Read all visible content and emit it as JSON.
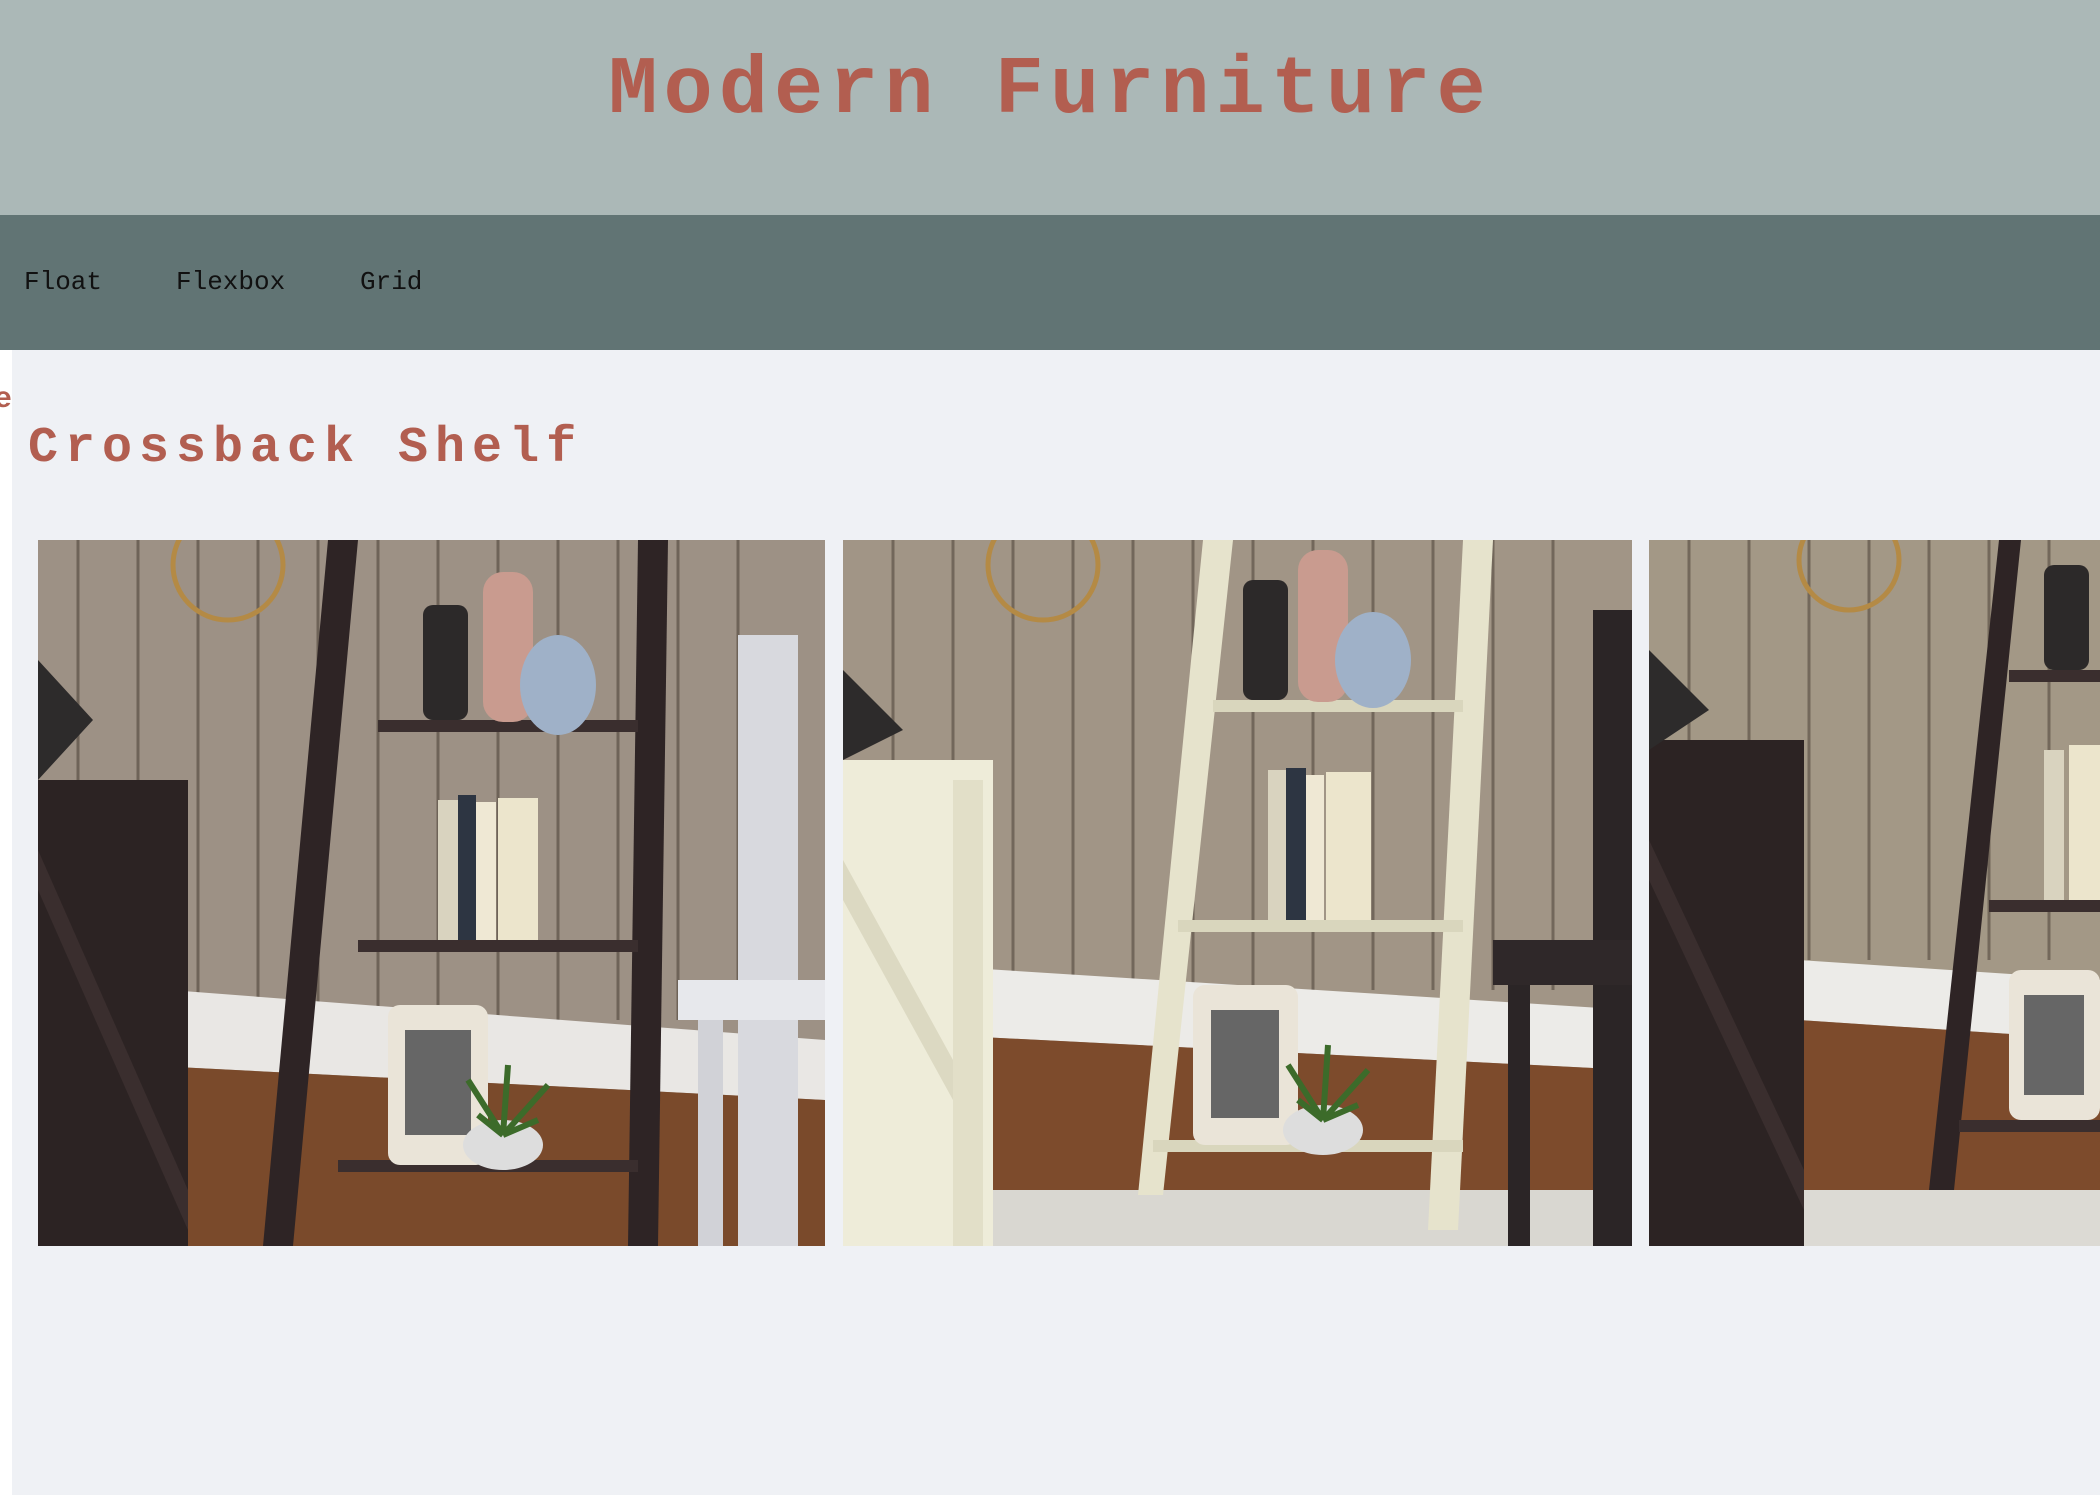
{
  "header": {
    "title": "Modern Furniture"
  },
  "nav": {
    "items": [
      "Float",
      "Flexbox",
      "Grid"
    ]
  },
  "main": {
    "clipped_heading_fragment": "e",
    "product_title": "Crossback Shelf",
    "photos": [
      {
        "name": "espresso-shelf-photo"
      },
      {
        "name": "ivory-shelf-photo"
      },
      {
        "name": "espresso-shelf-photo-cropped"
      }
    ]
  },
  "colors": {
    "header_bg": "#abb8b7",
    "nav_bg": "#617474",
    "accent_text": "#b25e50",
    "content_bg": "#eff1f5"
  }
}
